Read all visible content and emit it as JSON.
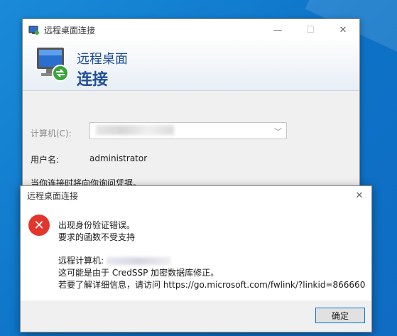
{
  "rdp_window": {
    "title": "远程桌面连接",
    "banner_line1": "远程桌面",
    "banner_line2": "连接",
    "computer_label": "计算机(C):",
    "username_label": "用户名:",
    "username_value": "administrator",
    "note": "当你连接时将向你询问凭据。"
  },
  "error_dialog": {
    "title": "远程桌面连接",
    "line1": "出现身份验证错误。",
    "line2": "要求的函数不受支持",
    "line3": "远程计算机:",
    "line4": "这可能是由于 CredSSP 加密数据库修正。",
    "line5": "若要了解详细信息，请访问 https://go.microsoft.com/fwlink/?linkid=866660",
    "ok_label": "确定"
  },
  "icons": {
    "window_controls": [
      "minimize-icon",
      "maximize-icon",
      "close-icon"
    ],
    "error": "error-x-icon",
    "app": "remote-desktop-icon"
  },
  "colors": {
    "desktop": "#0d72c7",
    "banner_text": "#1f4e96",
    "error_red": "#e2362c",
    "button_focus": "#0078d7"
  }
}
